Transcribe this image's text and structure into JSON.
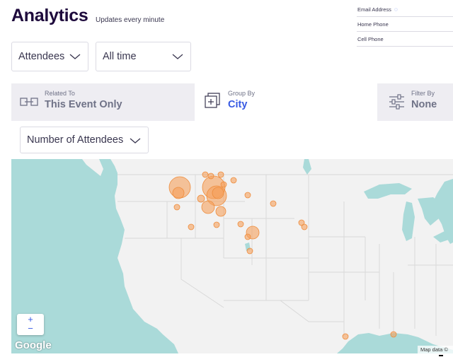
{
  "header": {
    "title": "Analytics",
    "subtitle": "Updates every minute"
  },
  "fields": [
    {
      "label": "Email Address",
      "icon": "sort-arrows-icon"
    },
    {
      "label": "Home Phone"
    },
    {
      "label": "Cell Phone"
    }
  ],
  "filters": {
    "attendees": "Attendees",
    "time": "All time",
    "metric": "Number of Attendees"
  },
  "tabs": {
    "related": {
      "small": "Related To",
      "big": "This Event Only"
    },
    "group": {
      "small": "Group By",
      "big": "City"
    },
    "filter": {
      "small": "Filter By",
      "big": "None"
    }
  },
  "map": {
    "zoom_in": "+",
    "zoom_out": "−",
    "attribution": "Map data ©",
    "logo_text": "Google",
    "marker_color": "#f5a05b",
    "water_color": "#aadad9",
    "land_color": "#f2f2f2"
  },
  "colors": {
    "brand_dark": "#1e0a3c",
    "accent_blue": "#3659e3",
    "muted": "#6f7287"
  }
}
